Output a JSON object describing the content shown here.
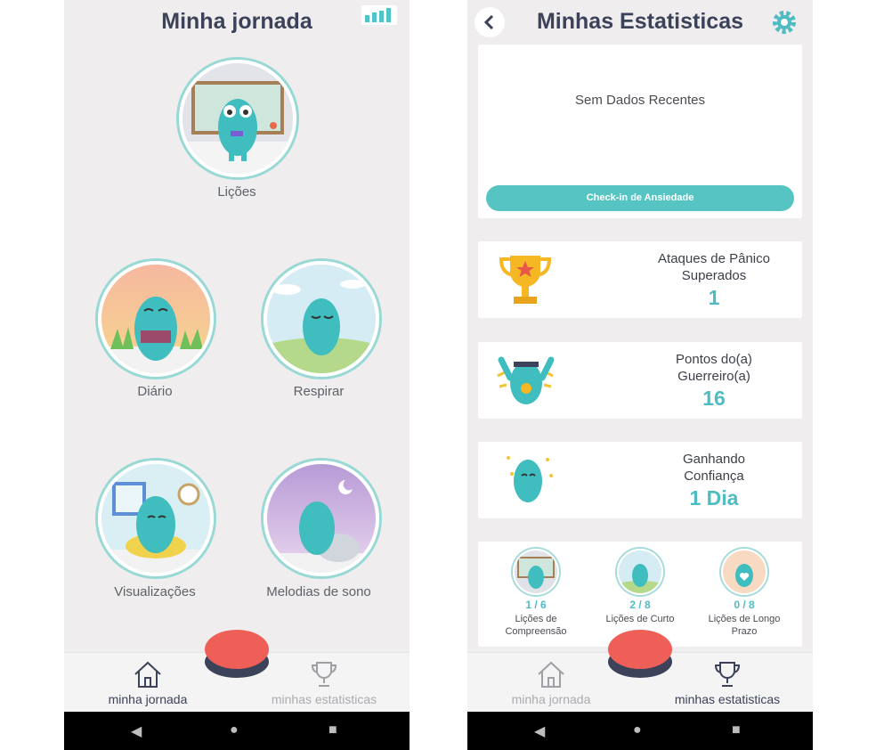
{
  "left_screen": {
    "title": "Minha jornada",
    "modules": [
      {
        "label": "Lições",
        "icon": "monster-classroom-icon"
      },
      {
        "label": "Diário",
        "icon": "monster-reading-sunset-icon"
      },
      {
        "label": "Respirar",
        "icon": "monster-breathing-outdoors-icon"
      },
      {
        "label": "Visualizações",
        "icon": "monster-window-clock-icon"
      },
      {
        "label": "Melodias de sono",
        "icon": "monster-night-moon-icon"
      }
    ],
    "nav": {
      "home_label": "minha jornada",
      "stats_label": "minhas estatisticas",
      "active": "home"
    }
  },
  "right_screen": {
    "title": "Minhas Estatisticas",
    "recent": {
      "empty_text": "Sem Dados Recentes",
      "button_label": "Check-in de Ansiedade"
    },
    "stats": [
      {
        "line1": "Ataques de Pânico",
        "line2": "Superados",
        "value": "1",
        "icon": "trophy-icon"
      },
      {
        "line1": "Pontos do(a)",
        "line2": "Guerreiro(a)",
        "value": "16",
        "icon": "monster-medal-icon"
      },
      {
        "line1": "Ganhando",
        "line2": "Confiança",
        "value": "1 Dia",
        "icon": "monster-sparkle-icon"
      }
    ],
    "lessons": [
      {
        "count": "1 / 6",
        "line1": "Lições de",
        "line2": "Compreensão"
      },
      {
        "count": "2 / 8",
        "line1": "Lições de Curto",
        "line2": ""
      },
      {
        "count": "0 / 8",
        "line1": "Lições de Longo",
        "line2": "Prazo"
      }
    ],
    "nav": {
      "home_label": "minha jornada",
      "stats_label": "minhas estatisticas",
      "active": "stats"
    }
  },
  "colors": {
    "teal": "#4fbcc3",
    "panic_button": "#ee5f57",
    "navy": "#3b4259",
    "background": "#efeded"
  }
}
